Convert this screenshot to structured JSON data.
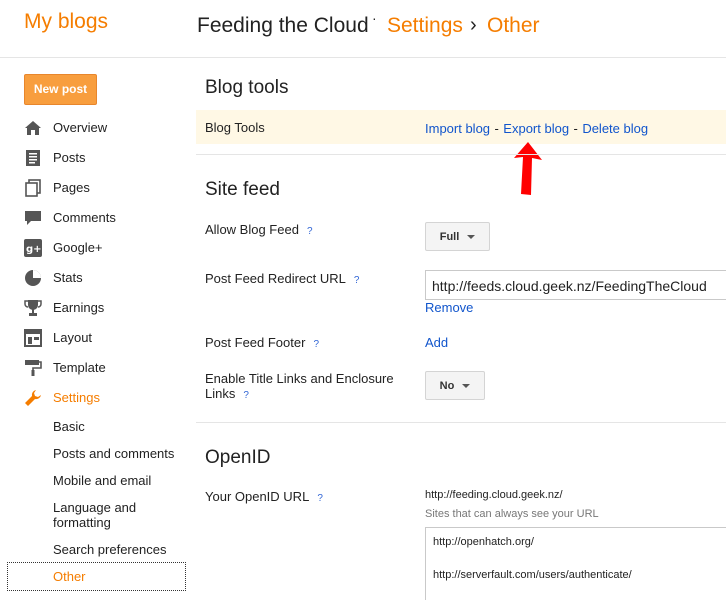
{
  "header": {
    "my_blogs": "My blogs",
    "blog_title": "Feeding the Cloud",
    "dot": "·",
    "crumb_settings": "Settings",
    "crumb_sep": "›",
    "crumb_current": "Other"
  },
  "sidebar": {
    "new_post": "New post",
    "items": [
      {
        "label": "Overview",
        "icon": "home-icon"
      },
      {
        "label": "Posts",
        "icon": "posts-icon"
      },
      {
        "label": "Pages",
        "icon": "pages-icon"
      },
      {
        "label": "Comments",
        "icon": "comment-icon"
      },
      {
        "label": "Google+",
        "icon": "google-plus-icon"
      },
      {
        "label": "Stats",
        "icon": "pie-chart-icon"
      },
      {
        "label": "Earnings",
        "icon": "trophy-icon"
      },
      {
        "label": "Layout",
        "icon": "layout-icon"
      },
      {
        "label": "Template",
        "icon": "paint-roller-icon"
      },
      {
        "label": "Settings",
        "icon": "wrench-icon"
      }
    ],
    "subitems": [
      "Basic",
      "Posts and comments",
      "Mobile and email",
      "Language and formatting",
      "Search preferences",
      "Other"
    ],
    "subitem_lang_line1": "Language and",
    "subitem_lang_line2": "formatting"
  },
  "blog_tools": {
    "section_title": "Blog tools",
    "row_label": "Blog Tools",
    "import": "Import blog",
    "export": "Export blog",
    "delete": "Delete blog",
    "dash": "-"
  },
  "site_feed": {
    "section_title": "Site feed",
    "allow_label": "Allow Blog Feed",
    "allow_value": "Full",
    "redirect_label": "Post Feed Redirect URL",
    "redirect_value": "http://feeds.cloud.geek.nz/FeedingTheCloud",
    "remove": "Remove",
    "footer_label": "Post Feed Footer",
    "footer_add": "Add",
    "enclosure_label_1": "Enable Title Links and Enclosure",
    "enclosure_label_2": "Links",
    "enclosure_value": "No",
    "help": "?"
  },
  "openid": {
    "section_title": "OpenID",
    "url_label": "Your OpenID URL",
    "url_value": "http://feeding.cloud.geek.nz/",
    "trusted_label": "Sites that can always see your URL",
    "trusted_sites": [
      "http://openhatch.org/",
      "http://serverfault.com/users/authenticate/"
    ]
  },
  "colors": {
    "accent": "#f57d00",
    "link": "#1155cc",
    "arrow": "#ff0000",
    "highlight": "#fff8e5"
  }
}
